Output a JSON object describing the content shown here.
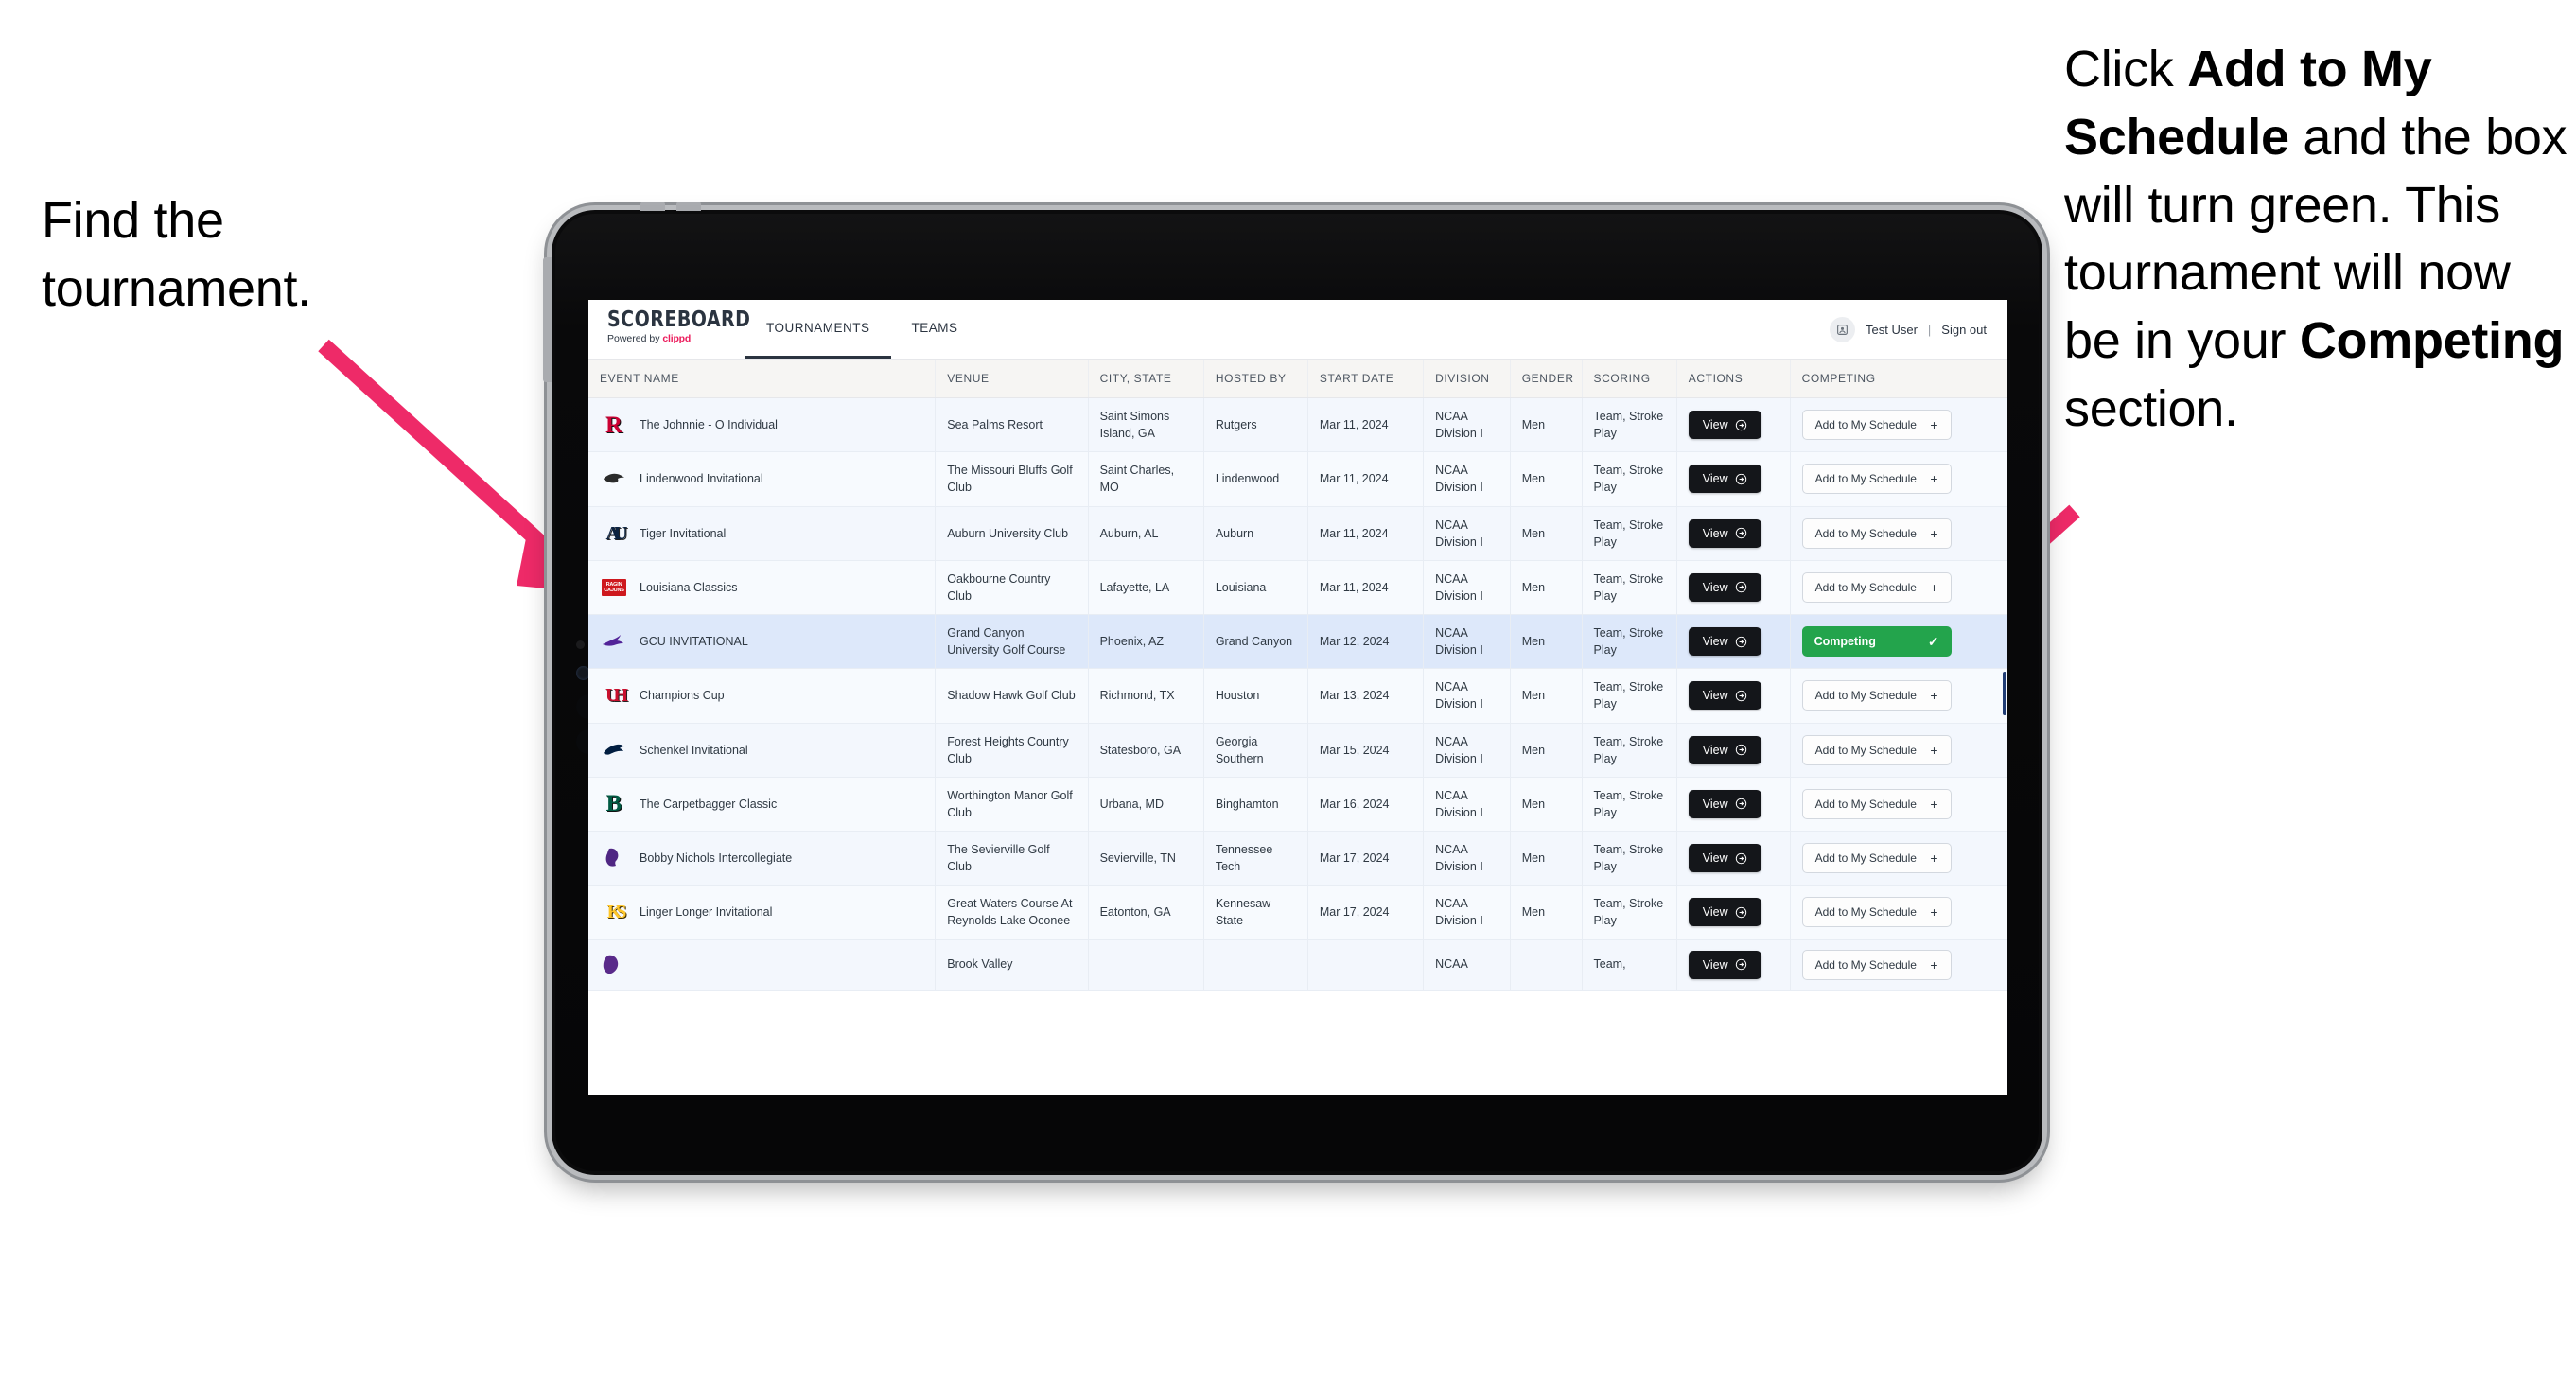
{
  "annotations": {
    "left": "Find the tournament.",
    "right_parts": [
      {
        "text": "Click ",
        "bold": false
      },
      {
        "text": "Add to My Schedule",
        "bold": true
      },
      {
        "text": " and the box will turn green. This tournament will now be in your ",
        "bold": false
      },
      {
        "text": "Competing",
        "bold": true
      },
      {
        "text": " section.",
        "bold": false
      }
    ],
    "arrow_color": "#ee2a68"
  },
  "app": {
    "logo": {
      "word": "SCOREBOARD",
      "powered_prefix": "Powered by ",
      "brand": "clippd",
      "brand_color": "#ec1c5c"
    },
    "tabs": [
      {
        "label": "TOURNAMENTS",
        "active": true
      },
      {
        "label": "TEAMS",
        "active": false
      }
    ],
    "user": {
      "name": "Test User",
      "separator": "|",
      "signout": "Sign out",
      "avatar_icon": "user-avatar-icon"
    }
  },
  "table": {
    "columns": [
      "EVENT NAME",
      "VENUE",
      "CITY, STATE",
      "HOSTED BY",
      "START DATE",
      "DIVISION",
      "GENDER",
      "SCORING",
      "ACTIONS",
      "COMPETING"
    ],
    "view_label": "View",
    "add_label": "Add to My Schedule",
    "add_plus": "+",
    "competing_label": "Competing",
    "competing_check": "✓",
    "rows": [
      {
        "event": "The Johnnie - O Individual",
        "venue": "Sea Palms Resort",
        "city": "Saint Simons Island, GA",
        "hosted_by": "Rutgers",
        "start_date": "Mar 11, 2024",
        "division": "NCAA Division I",
        "gender": "Men",
        "scoring": "Team, Stroke Play",
        "competing": false,
        "logo": {
          "name": "rutgers-logo",
          "type": "letter",
          "text": "R",
          "color": "#cc0033"
        }
      },
      {
        "event": "Lindenwood Invitational",
        "venue": "The Missouri Bluffs Golf Club",
        "city": "Saint Charles, MO",
        "hosted_by": "Lindenwood",
        "start_date": "Mar 11, 2024",
        "division": "NCAA Division I",
        "gender": "Men",
        "scoring": "Team, Stroke Play",
        "competing": false,
        "logo": {
          "name": "lindenwood-lion-logo",
          "type": "lion",
          "text": "",
          "color": "#2b2b2b"
        }
      },
      {
        "event": "Tiger Invitational",
        "venue": "Auburn University Club",
        "city": "Auburn, AL",
        "hosted_by": "Auburn",
        "start_date": "Mar 11, 2024",
        "division": "NCAA Division I",
        "gender": "Men",
        "scoring": "Team, Stroke Play",
        "competing": false,
        "logo": {
          "name": "auburn-au-logo",
          "type": "au",
          "text": "AU",
          "color": "#0c2340"
        }
      },
      {
        "event": "Louisiana Classics",
        "venue": "Oakbourne Country Club",
        "city": "Lafayette, LA",
        "hosted_by": "Louisiana",
        "start_date": "Mar 11, 2024",
        "division": "NCAA Division I",
        "gender": "Men",
        "scoring": "Team, Stroke Play",
        "competing": false,
        "logo": {
          "name": "ragin-cajuns-logo",
          "type": "cajuns",
          "text": "RAGIN CAJUNS",
          "color": "#ce181e"
        }
      },
      {
        "event": "GCU INVITATIONAL",
        "venue": "Grand Canyon University Golf Course",
        "city": "Phoenix, AZ",
        "hosted_by": "Grand Canyon",
        "start_date": "Mar 12, 2024",
        "division": "NCAA Division I",
        "gender": "Men",
        "scoring": "Team, Stroke Play",
        "competing": true,
        "logo": {
          "name": "grand-canyon-lopes-logo",
          "type": "lope",
          "text": "",
          "color": "#522398"
        }
      },
      {
        "event": "Champions Cup",
        "venue": "Shadow Hawk Golf Club",
        "city": "Richmond, TX",
        "hosted_by": "Houston",
        "start_date": "Mar 13, 2024",
        "division": "NCAA Division I",
        "gender": "Men",
        "scoring": "Team, Stroke Play",
        "competing": false,
        "logo": {
          "name": "houston-uh-logo",
          "type": "uh",
          "text": "UH",
          "color": "#c8102e"
        }
      },
      {
        "event": "Schenkel Invitational",
        "venue": "Forest Heights Country Club",
        "city": "Statesboro, GA",
        "hosted_by": "Georgia Southern",
        "start_date": "Mar 15, 2024",
        "division": "NCAA Division I",
        "gender": "Men",
        "scoring": "Team, Stroke Play",
        "competing": false,
        "logo": {
          "name": "georgia-southern-eagle-logo",
          "type": "eagle",
          "text": "",
          "color": "#011e41"
        }
      },
      {
        "event": "The Carpetbagger Classic",
        "venue": "Worthington Manor Golf Club",
        "city": "Urbana, MD",
        "hosted_by": "Binghamton",
        "start_date": "Mar 16, 2024",
        "division": "NCAA Division I",
        "gender": "Men",
        "scoring": "Team, Stroke Play",
        "competing": false,
        "logo": {
          "name": "binghamton-b-logo",
          "type": "letter",
          "text": "B",
          "color": "#005a43"
        }
      },
      {
        "event": "Bobby Nichols Intercollegiate",
        "venue": "The Sevierville Golf Club",
        "city": "Sevierville, TN",
        "hosted_by": "Tennessee Tech",
        "start_date": "Mar 17, 2024",
        "division": "NCAA Division I",
        "gender": "Men",
        "scoring": "Team, Stroke Play",
        "competing": false,
        "logo": {
          "name": "tennessee-tech-eagle-logo",
          "type": "goldeagle",
          "text": "",
          "color": "#4f2683"
        }
      },
      {
        "event": "Linger Longer Invitational",
        "venue": "Great Waters Course At Reynolds Lake Oconee",
        "city": "Eatonton, GA",
        "hosted_by": "Kennesaw State",
        "start_date": "Mar 17, 2024",
        "division": "NCAA Division I",
        "gender": "Men",
        "scoring": "Team, Stroke Play",
        "competing": false,
        "logo": {
          "name": "kennesaw-state-ks-logo",
          "type": "ks",
          "text": "KS",
          "color": "#ffc629"
        }
      },
      {
        "event": "",
        "venue": "Brook Valley",
        "city": "",
        "hosted_by": "",
        "start_date": "",
        "division": "NCAA",
        "gender": "",
        "scoring": "Team,",
        "competing": false,
        "partial": true,
        "logo": {
          "name": "ecu-pirates-logo",
          "type": "pirate",
          "text": "",
          "color": "#592a8a"
        }
      }
    ]
  },
  "colors": {
    "competing_green": "#23a44c",
    "selected_row": "#dde8fa",
    "row": "#f3f7fd",
    "header_bg": "#f6f5f3",
    "dark_button": "#14161a"
  }
}
